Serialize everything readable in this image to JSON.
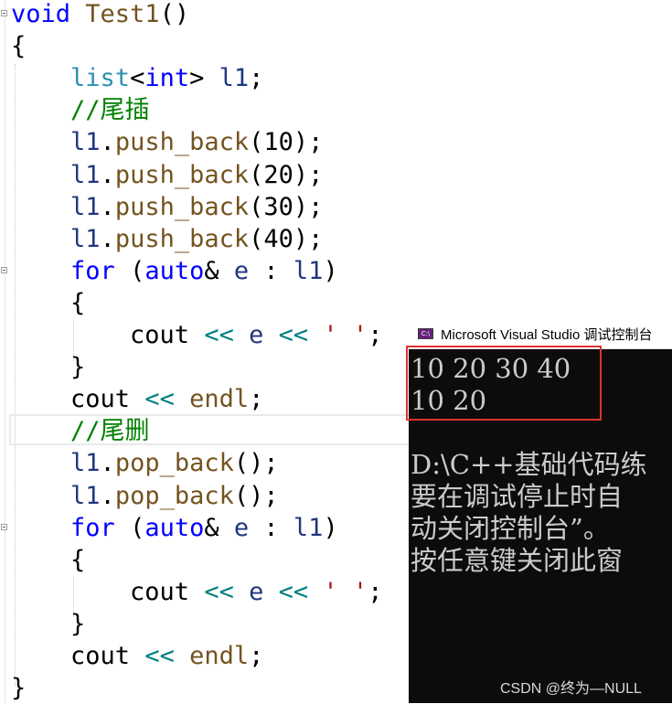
{
  "code": {
    "lines": [
      [
        "kw:void",
        "fn: Test1",
        "tx:()"
      ],
      [
        "tx:{"
      ],
      [
        "tx:    ",
        "ty:list",
        "tx:<",
        "kw:int",
        "tx:> ",
        "var:l1",
        "tx:;"
      ],
      [
        "tx:    ",
        "cm://尾插"
      ],
      [
        "tx:    ",
        "var:l1",
        "tx:.",
        "fn:push_back",
        "tx:(10);"
      ],
      [
        "tx:    ",
        "var:l1",
        "tx:.",
        "fn:push_back",
        "tx:(20);"
      ],
      [
        "tx:    ",
        "var:l1",
        "tx:.",
        "fn:push_back",
        "tx:(30);"
      ],
      [
        "tx:    ",
        "var:l1",
        "tx:.",
        "fn:push_back",
        "tx:(40);"
      ],
      [
        "tx:    ",
        "kw:for",
        "tx: (",
        "kw:auto",
        "tx:& ",
        "var:e",
        "tx: : ",
        "var:l1",
        "tx:)"
      ],
      [
        "tx:    {"
      ],
      [
        "tx:        cout ",
        "op:<<",
        "tx: ",
        "var:e",
        "tx: ",
        "op:<<",
        "tx: ",
        "st:' '",
        "tx:;"
      ],
      [
        "tx:    }"
      ],
      [
        "tx:    cout ",
        "op:<<",
        "tx: ",
        "fn:endl",
        "tx:;"
      ],
      [
        "tx:    ",
        "cm://尾删"
      ],
      [
        "tx:    ",
        "var:l1",
        "tx:.",
        "fn:pop_back",
        "tx:();"
      ],
      [
        "tx:    ",
        "var:l1",
        "tx:.",
        "fn:pop_back",
        "tx:();"
      ],
      [
        "tx:    ",
        "kw:for",
        "tx: (",
        "kw:auto",
        "tx:& ",
        "var:e",
        "tx: : ",
        "var:l1",
        "tx:)"
      ],
      [
        "tx:    {"
      ],
      [
        "tx:        cout ",
        "op:<<",
        "tx: ",
        "var:e",
        "tx: ",
        "op:<<",
        "tx: ",
        "st:' '",
        "tx:;"
      ],
      [
        "tx:    }"
      ],
      [
        "tx:    cout ",
        "op:<<",
        "tx: ",
        "fn:endl",
        "tx:;"
      ],
      [
        "tx:}"
      ]
    ]
  },
  "console": {
    "icon_label": "C:\\",
    "title": "Microsoft Visual Studio 调试控制台",
    "output_lines": [
      "10 20 30 40",
      "10 20",
      "",
      "D:\\C++基础代码练",
      "要在调试停止时自",
      "动关闭控制台”。",
      "按任意键关闭此窗"
    ]
  },
  "watermark": "CSDN @终为—NULL",
  "colors": {
    "keyword": "#0000ff",
    "type": "#2b91af",
    "function": "#74531f",
    "comment": "#008000",
    "string": "#a31515",
    "operator": "#008080",
    "variable": "#1f377f",
    "console_bg": "#0c0c0c",
    "console_text": "#cccccc",
    "highlight_border": "#e0332f"
  }
}
